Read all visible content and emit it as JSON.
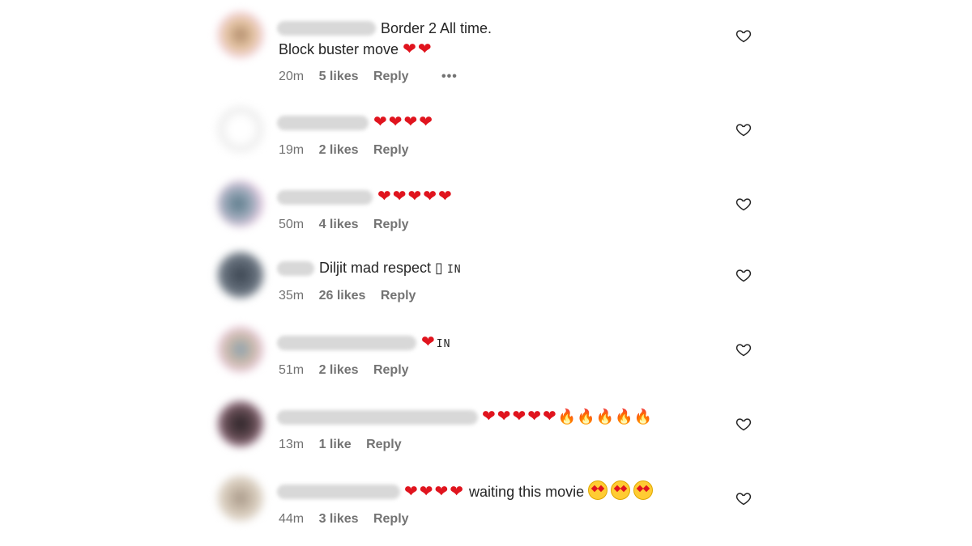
{
  "comments": [
    {
      "lines": [
        "Border 2 All time.",
        "Block buster move"
      ],
      "line2_suffix": "❤❤",
      "time": "20m",
      "likes": "5 likes",
      "reply": "Reply",
      "more": "•••"
    },
    {
      "text": "❤❤❤❤",
      "time": "19m",
      "likes": "2 likes",
      "reply": "Reply"
    },
    {
      "text": "❤❤❤❤❤",
      "time": "50m",
      "likes": "4 likes",
      "reply": "Reply"
    },
    {
      "text": "Diljit mad respect ▯",
      "suffix": "IN",
      "time": "35m",
      "likes": "26 likes",
      "reply": "Reply"
    },
    {
      "text": "❤",
      "suffix": "IN",
      "time": "51m",
      "likes": "2 likes",
      "reply": "Reply"
    },
    {
      "hearts": "❤❤❤❤❤",
      "fires": "🔥🔥🔥🔥🔥",
      "time": "13m",
      "likes": "1 like",
      "reply": "Reply"
    },
    {
      "hearts": "❤❤❤❤",
      "text": "waiting this movie",
      "time": "44m",
      "likes": "3 likes",
      "reply": "Reply"
    }
  ],
  "colors": {
    "heart": "#e0141e",
    "meta_text": "#737373",
    "comment_text": "#262626"
  },
  "icons": {
    "like": "heart-outline-icon",
    "more": "more-horizontal-icon"
  }
}
